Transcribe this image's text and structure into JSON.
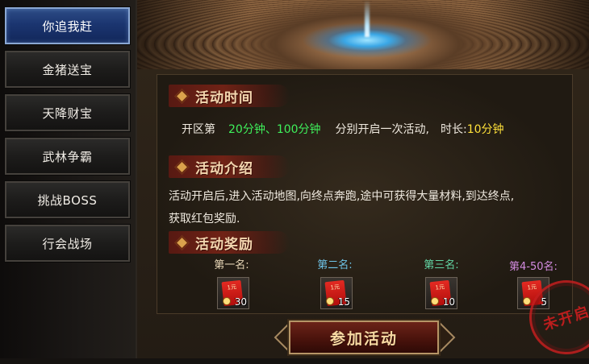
{
  "sidebar": {
    "items": [
      {
        "label": "你追我赶",
        "active": true
      },
      {
        "label": "金猪送宝",
        "active": false
      },
      {
        "label": "天降财宝",
        "active": false
      },
      {
        "label": "武林争霸",
        "active": false
      },
      {
        "label": "挑战BOSS",
        "active": false
      },
      {
        "label": "行会战场",
        "active": false
      }
    ]
  },
  "sections": {
    "time": {
      "title": "活动时间",
      "prefix": "开区第",
      "times": "20分钟、100分钟",
      "middle": "分别开启一次活动,",
      "duration_label": "时长:",
      "duration_value": "10分钟"
    },
    "intro": {
      "title": "活动介绍",
      "line1": "活动开启后,进入活动地图,向终点奔跑,途中可获得大量材料,到达终点,",
      "line2": "获取红包奖励."
    },
    "rewards": {
      "title": "活动奖励",
      "ranks": [
        {
          "label": "第一名:",
          "color": "#e9d8b8",
          "envelope_text": "1元",
          "qty": "30"
        },
        {
          "label": "第二名:",
          "color": "#6fc4e8",
          "envelope_text": "1元",
          "qty": "15"
        },
        {
          "label": "第三名:",
          "color": "#63d6a5",
          "envelope_text": "1元",
          "qty": "10"
        },
        {
          "label": "第4-50名:",
          "color": "#d38be0",
          "envelope_text": "1元",
          "qty": "5"
        }
      ]
    }
  },
  "join_button": {
    "label": "参加活动"
  },
  "stamp": {
    "label": "未开启"
  },
  "colors": {
    "highlight_green": "#3ef05b",
    "highlight_yellow": "#ffe13a",
    "active_tab": "#1b3570"
  }
}
